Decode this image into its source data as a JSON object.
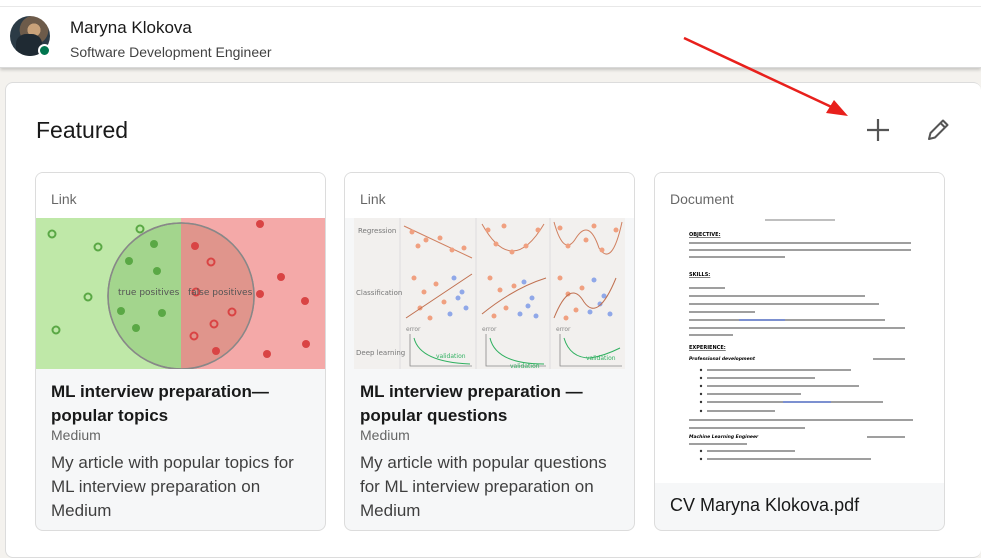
{
  "profile": {
    "name": "Maryna Klokova",
    "headline": "Software Development Engineer"
  },
  "featured": {
    "title": "Featured",
    "items": [
      {
        "type": "Link",
        "title": "ML interview preparation—popular topics",
        "source": "Medium",
        "description": "My article with popular topics for ML interview preparation on Medium",
        "thumb_labels": [
          "true positives",
          "false positives"
        ]
      },
      {
        "type": "Link",
        "title": "ML interview preparation — popular questions",
        "source": "Medium",
        "description": "My article with popular questions for ML interview preparation on Medium",
        "thumb_labels": [
          "Regression",
          "Classification",
          "Deep learning",
          "error",
          "error",
          "error",
          "validation",
          "validation",
          "validation"
        ]
      },
      {
        "type": "Document",
        "title": "CV Maryna Klokova.pdf",
        "doc_headings": [
          "OBJECTIVE:",
          "SKILLS:",
          "EXPERIENCE:"
        ],
        "doc_jobs": [
          "Professional development",
          "Machine Learning Engineer"
        ]
      }
    ]
  },
  "colors": {
    "accent_online": "#01754f",
    "annotation_arrow": "#e8201c",
    "true_region": "#bfe8a8",
    "false_region": "#f4a9a8"
  }
}
